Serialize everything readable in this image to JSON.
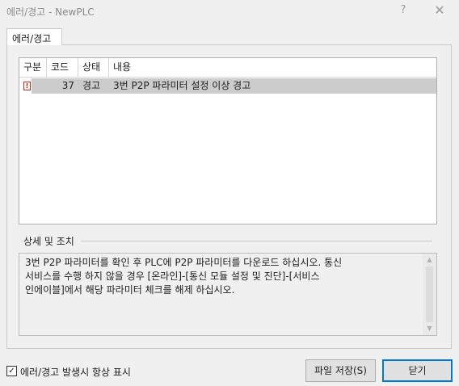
{
  "window": {
    "title": "에러/경고 - NewPLC",
    "help_label": "?",
    "close_label": "✕"
  },
  "tab": {
    "label": "에러/경고"
  },
  "table": {
    "columns": [
      "구분",
      "코드",
      "상태",
      "내용"
    ],
    "rows": [
      {
        "type_icon": "!",
        "code": "37",
        "status": "경고",
        "content": "3번 P2P 파라미터 설정 이상 경고"
      }
    ]
  },
  "details": {
    "label": "상세 및 조치",
    "text": "3번 P2P 파라미터를 확인 후 PLC에 P2P 파라미터를 다운로드 하십시오. 통신\n서비스를 수행 하지 않을 경우 [온라인]-[통신 모듈 설정 및 진단]-[서비스\n인에이블]에서 해당 파라미터 체크를 해제 하십시오."
  },
  "footer": {
    "always_show_label": "에러/경고 발생시 항상 표시",
    "always_show_checked": true,
    "save_label": "파일 저장(S)",
    "close_label": "닫기"
  }
}
